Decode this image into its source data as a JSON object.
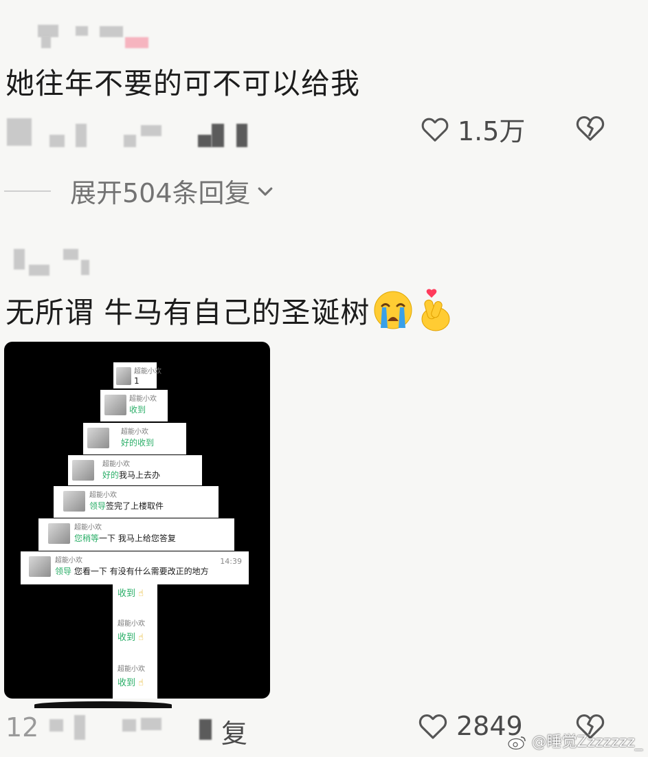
{
  "comments": [
    {
      "text": "她往年不要的可不可以给我",
      "likes": "1.5万",
      "expand_label": "展开504条回复"
    },
    {
      "text": "无所谓 牛马有自己的圣诞树",
      "likes": "2849",
      "reply_label": "复",
      "date_prefix": "12",
      "image": {
        "messages": [
          {
            "name": "超能小欢",
            "text": "1",
            "green": ""
          },
          {
            "name": "超能小欢",
            "text": "",
            "green": "收到"
          },
          {
            "name": "超能小欢",
            "text": "",
            "green": "好的收到"
          },
          {
            "name": "超能小欢",
            "text": "我马上去办",
            "green": "好的"
          },
          {
            "name": "超能小欢",
            "text": "签完了上楼取件",
            "green": "领导"
          },
          {
            "name": "超能小欢",
            "text": "一下 我马上给您答复",
            "green": "您稍等"
          },
          {
            "name": "超能小欢",
            "text": "您看一下 有没有什么需要改正的地方",
            "green": "领导",
            "time": "14:39"
          }
        ],
        "trunk": [
          {
            "name": "",
            "green": "收到"
          },
          {
            "name": "超能小欢",
            "green": "收到"
          },
          {
            "name": "超能小欢",
            "green": "收到"
          }
        ]
      }
    }
  ],
  "watermark": "@睡觉Zzzzzzz_",
  "icons": [
    "heart-outline-icon",
    "broken-heart-icon",
    "crying-face-emoji",
    "finger-heart-emoji",
    "chevron-down-icon",
    "weibo-icon"
  ]
}
